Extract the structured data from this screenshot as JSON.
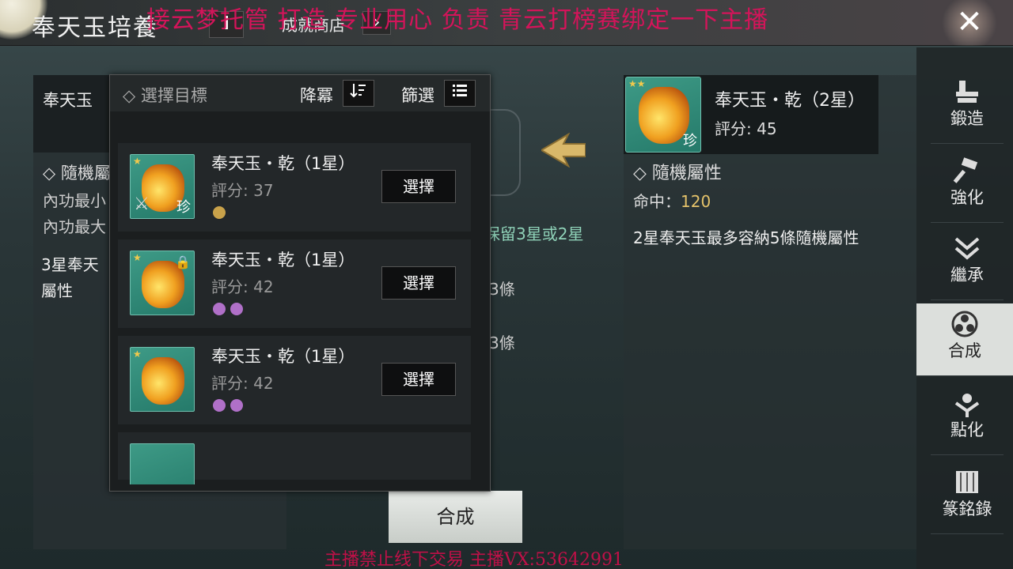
{
  "header": {
    "title": "奉天玉培養",
    "info_label": "i",
    "shop_label": "成就商店",
    "shop_arrow": "›",
    "close_label": "✕",
    "watermark_top": "接云梦托管 打造 专业用心 负责   青云打榜赛绑定一下主播",
    "watermark_bottom": "主播禁止线下交易    主播VX:53642991"
  },
  "left_panel": {
    "name": "奉天玉",
    "attr_title": "◇ 隨機屬",
    "line1": "內功最小",
    "line2": "內功最大",
    "note": "3星奉天屬性"
  },
  "center": {
    "keep_text": "保留3星或2星",
    "row1_suffix": "3條",
    "row2_suffix": "3條",
    "combine_label": "合成"
  },
  "right_panel": {
    "name": "奉天玉・乾（2星）",
    "score": "評分: 45",
    "badge": "珍",
    "stars": "★★",
    "attr_title": "◇ 隨機屬性",
    "stat_label": "命中：",
    "stat_value": "120",
    "note": "2星奉天玉最多容納5條隨機屬性"
  },
  "side_nav": {
    "items": [
      {
        "label": "鍛造",
        "icon": "anvil-icon"
      },
      {
        "label": "強化",
        "icon": "hammer-icon"
      },
      {
        "label": "繼承",
        "icon": "inherit-icon"
      },
      {
        "label": "合成",
        "icon": "combine-icon",
        "active": true
      },
      {
        "label": "點化",
        "icon": "enlighten-icon"
      },
      {
        "label": "篆銘錄",
        "icon": "scroll-icon"
      }
    ]
  },
  "popup": {
    "title": "◇ 選擇目標",
    "sort_label": "降冪",
    "filter_label": "篩選",
    "items": [
      {
        "name": "奉天玉・乾（1星）",
        "score": "評分: 37",
        "select": "選擇",
        "star": "★",
        "badge": "珍",
        "dots": [
          "#c9a24a"
        ]
      },
      {
        "name": "奉天玉・乾（1星）",
        "score": "評分: 42",
        "select": "選擇",
        "star": "★",
        "badge": "",
        "dots": [
          "#b070c8",
          "#b070c8"
        ]
      },
      {
        "name": "奉天玉・乾（1星）",
        "score": "評分: 42",
        "select": "選擇",
        "star": "★",
        "badge": "",
        "dots": [
          "#b070c8",
          "#b070c8"
        ]
      }
    ]
  },
  "colors": {
    "accent_gold": "#e5c36a",
    "keep_text": "#8fd2b8",
    "watermark": "#d4145a",
    "rarity_teal": "#2f8a78"
  }
}
